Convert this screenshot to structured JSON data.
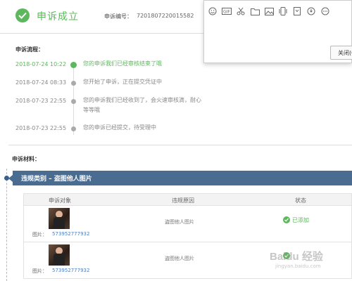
{
  "header": {
    "title": "申诉成立",
    "complaint_no_label": "申诉编号：",
    "complaint_no": "7201807220015582"
  },
  "popup": {
    "icons": [
      "smile-icon",
      "gif-icon",
      "scissors-icon",
      "folder-icon",
      "image-icon",
      "phone-icon",
      "sticker-icon",
      "record-icon",
      "more-icon"
    ],
    "close_label": "关闭(C"
  },
  "process": {
    "label": "申诉流程：",
    "steps": [
      {
        "time": "2018-07-24 10:22",
        "text": "您的申诉我们已经审核结束了哦"
      },
      {
        "time": "2018-07-24 08:33",
        "text": "您开始了申诉，正在提交凭证中"
      },
      {
        "time": "2018-07-23 22:55",
        "text": "您的申诉我们已经收到了，会火速审核滴，耐心等等哦"
      },
      {
        "time": "2018-07-23 22:55",
        "text": "您的申诉已经提交，待受理中"
      }
    ]
  },
  "materials": {
    "label": "申诉材料：",
    "category": "违规类别 – 盗图他人图片",
    "columns": [
      "申诉对象",
      "违规原因",
      "状态"
    ],
    "rows": [
      {
        "pic_label": "图片：",
        "pic_id": "573952777932",
        "reason": "盗图他人图片",
        "status": "已添加"
      },
      {
        "pic_label": "图片：",
        "pic_id": "573952777932",
        "reason": "盗图他人图片",
        "status": ""
      }
    ]
  },
  "watermark": {
    "text": "Baidu 经验",
    "sub": "jingyan.baidu.com"
  },
  "colors": {
    "success": "#5cb85c",
    "category_bar": "#4a6c91",
    "link": "#4a7fc1"
  }
}
